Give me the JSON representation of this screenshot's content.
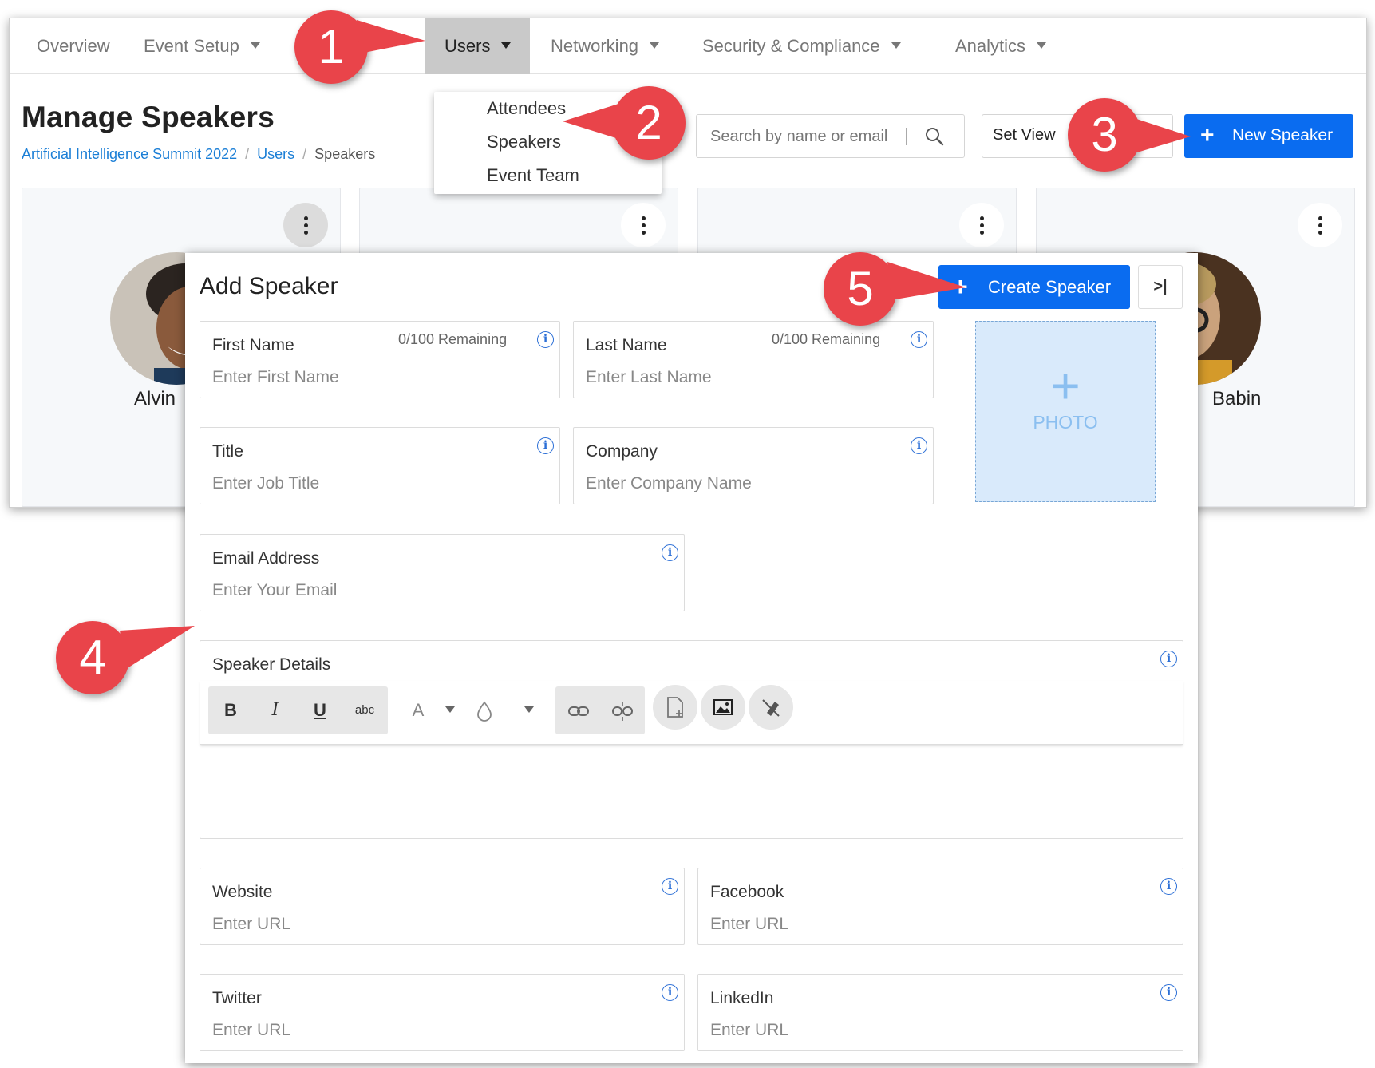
{
  "nav": {
    "items": [
      {
        "label": "Overview",
        "has_caret": false
      },
      {
        "label": "Event Setup",
        "has_caret": true
      },
      {
        "label": "Users",
        "has_caret": true,
        "active": true
      },
      {
        "label": "Networking",
        "has_caret": true
      },
      {
        "label": "Security & Compliance",
        "has_caret": true
      },
      {
        "label": "Analytics",
        "has_caret": true
      }
    ]
  },
  "users_menu": {
    "items": [
      "Attendees",
      "Speakers",
      "Event Team"
    ]
  },
  "header": {
    "title": "Manage Speakers",
    "breadcrumb": [
      "Artificial Intelligence Summit 2022",
      "Users",
      "Speakers"
    ],
    "search_placeholder": "Search by name or email",
    "set_view_label": "Set View",
    "new_speaker_label": "New Speaker"
  },
  "cards": [
    {
      "name": "Alvin"
    },
    {
      "name": ""
    },
    {
      "name": ""
    },
    {
      "name": "Babin"
    }
  ],
  "add_speaker": {
    "title": "Add Speaker",
    "create_label": "Create Speaker",
    "collapse_label": ">|",
    "photo_label": "PHOTO",
    "photo_plus": "+",
    "fields": {
      "first_name": {
        "label": "First Name",
        "placeholder": "Enter First Name",
        "remaining": "0/100 Remaining"
      },
      "last_name": {
        "label": "Last Name",
        "placeholder": "Enter Last Name",
        "remaining": "0/100 Remaining"
      },
      "title": {
        "label": "Title",
        "placeholder": "Enter Job Title"
      },
      "company": {
        "label": "Company",
        "placeholder": "Enter Company Name"
      },
      "email": {
        "label": "Email Address",
        "placeholder": "Enter Your Email"
      },
      "details": {
        "label": "Speaker Details"
      },
      "website": {
        "label": "Website",
        "placeholder": "Enter URL"
      },
      "facebook": {
        "label": "Facebook",
        "placeholder": "Enter URL"
      },
      "twitter": {
        "label": "Twitter",
        "placeholder": "Enter URL"
      },
      "linkedin": {
        "label": "LinkedIn",
        "placeholder": "Enter URL"
      }
    },
    "toolbar": {
      "bold": "B",
      "italic": "I",
      "underline": "U",
      "strikethrough": "abc",
      "font_color": "A",
      "icons": [
        "bold-icon",
        "italic-icon",
        "underline-icon",
        "strikethrough-icon",
        "font-color-icon",
        "fill-color-icon",
        "link-icon",
        "unlink-icon",
        "insert-file-icon",
        "insert-image-icon",
        "clear-format-icon"
      ]
    }
  },
  "callouts": [
    "1",
    "2",
    "3",
    "4",
    "5"
  ],
  "colors": {
    "primary": "#0a6cf0",
    "link": "#1a7ed6",
    "callout": "#e9444a",
    "photo_bg": "#d9eafb",
    "info": "#2c6fd6"
  }
}
